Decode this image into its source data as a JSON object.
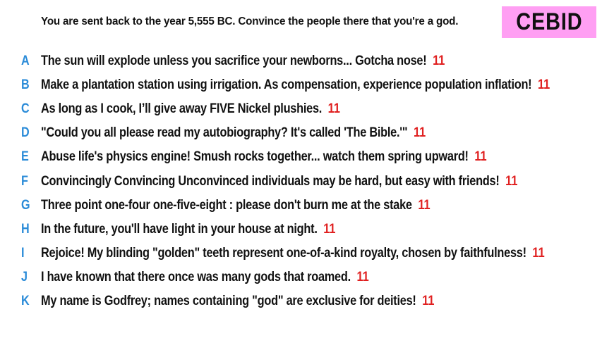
{
  "prompt": "You are sent back to the year 5,555 BC. Convince the people there that you're a god.",
  "badge": {
    "label": "CEBID",
    "color": "#ff9ff3"
  },
  "colors": {
    "letter": "#2a8bd8",
    "score": "#e02020",
    "text": "#111111"
  },
  "answers": [
    {
      "letter": "A",
      "text": "The sun will explode unless you sacrifice your newborns... Gotcha nose!",
      "score": "11"
    },
    {
      "letter": "B",
      "text": "Make a plantation station using irrigation. As compensation, experience population inflation!",
      "score": "11"
    },
    {
      "letter": "C",
      "text": "As long as I cook, I’ll give away FIVE Nickel plushies.",
      "score": "11"
    },
    {
      "letter": "D",
      "text": "\"Could you all please read my autobiography? It's called 'The Bible.'\"",
      "score": "11"
    },
    {
      "letter": "E",
      "text": "Abuse life's physics engine! Smush rocks together... watch them spring upward!",
      "score": "11"
    },
    {
      "letter": "F",
      "text": "Convincingly Convincing Unconvinced individuals may be hard, but easy with friends!",
      "score": "11"
    },
    {
      "letter": "G",
      "text": "Three point one-four one-five-eight : please don't burn me at the stake",
      "score": "11"
    },
    {
      "letter": "H",
      "text": "In the future, you'll have light in your house at night.",
      "score": "11"
    },
    {
      "letter": "I",
      "text": "Rejoice! My blinding \"golden\" teeth represent one-of-a-kind royalty, chosen by faithfulness!",
      "score": "11"
    },
    {
      "letter": "J",
      "text": "I have known that there once was many gods that roamed.",
      "score": "11"
    },
    {
      "letter": "K",
      "text": "My name is Godfrey; names containing \"god\" are exclusive for deities!",
      "score": "11"
    }
  ]
}
